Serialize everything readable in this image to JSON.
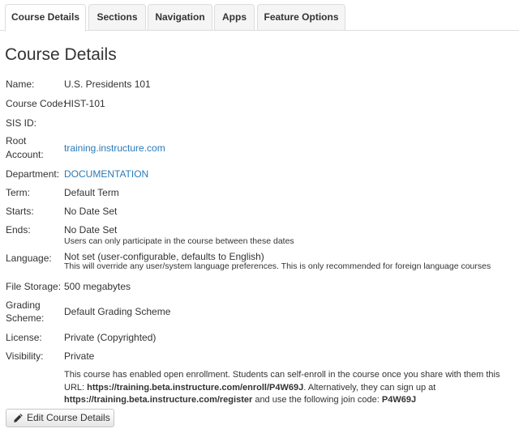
{
  "tabs": [
    {
      "label": "Course Details",
      "active": true
    },
    {
      "label": "Sections",
      "active": false
    },
    {
      "label": "Navigation",
      "active": false
    },
    {
      "label": "Apps",
      "active": false
    },
    {
      "label": "Feature Options",
      "active": false
    }
  ],
  "page_title": "Course Details",
  "fields": {
    "name": {
      "label": "Name:",
      "value": "U.S. Presidents 101"
    },
    "course_code": {
      "label": "Course Code:",
      "value": "HIST-101"
    },
    "sis_id": {
      "label": "SIS ID:",
      "value": ""
    },
    "root_account": {
      "label_line1": "Root",
      "label_line2": "Account:",
      "value": "training.instructure.com"
    },
    "department": {
      "label": "Department:",
      "value": "DOCUMENTATION"
    },
    "term": {
      "label": "Term:",
      "value": "Default Term"
    },
    "starts": {
      "label": "Starts:",
      "value": "No Date Set"
    },
    "ends": {
      "label": "Ends:",
      "value": "No Date Set",
      "hint": "Users can only participate in the course between these dates"
    },
    "language": {
      "label": "Language:",
      "value": "Not set (user-configurable, defaults to English)",
      "hint": "This will override any user/system language preferences. This is only recommended for foreign language courses"
    },
    "file_storage": {
      "label": "File Storage:",
      "value": "500 megabytes"
    },
    "grading_scheme": {
      "label_line1": "Grading",
      "label_line2": "Scheme:",
      "value": "Default Grading Scheme"
    },
    "license": {
      "label": "License:",
      "value": "Private (Copyrighted)"
    },
    "visibility": {
      "label": "Visibility:",
      "value": "Private"
    }
  },
  "enrollment": {
    "text1": "This course has enabled open enrollment. Students can self-enroll in the course once you share with them this URL: ",
    "enroll_url": "https://training.beta.instructure.com/enroll/P4W69J",
    "text2": ". Alternatively, they can sign up at ",
    "register_url": "https://training.beta.instructure.com/register",
    "text3": " and use the following join code: ",
    "join_code": "P4W69J"
  },
  "edit_button": {
    "label": "Edit Course Details",
    "icon": "pencil-icon"
  },
  "colors": {
    "link": "#2a7ab9",
    "text": "#333333",
    "tab_bg": "#f5f5f5",
    "border": "#dddddd"
  }
}
